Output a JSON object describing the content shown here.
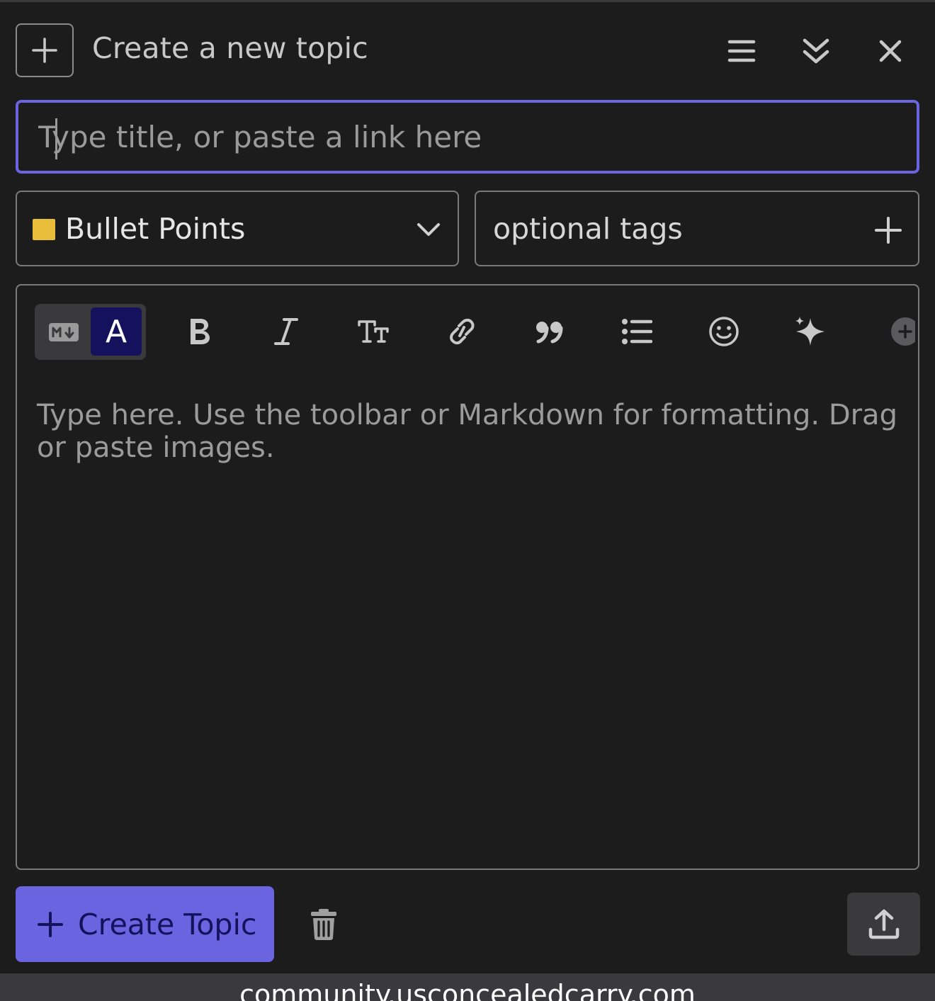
{
  "header": {
    "title": "Create a new topic"
  },
  "title_input": {
    "placeholder": "Type title, or paste a link here",
    "value": ""
  },
  "category": {
    "label": "Bullet Points",
    "color": "#e8be3a"
  },
  "tags": {
    "placeholder": "optional tags"
  },
  "editor": {
    "mode_rich_label": "A",
    "placeholder": "Type here. Use the toolbar or Markdown for formatting. Drag or paste images."
  },
  "footer": {
    "create_label": "Create Topic"
  },
  "browser": {
    "url": "community.usconcealedcarry.com"
  },
  "colors": {
    "accent": "#6b64e0",
    "accent_dark": "#14125c",
    "background": "#1c1c1d"
  }
}
